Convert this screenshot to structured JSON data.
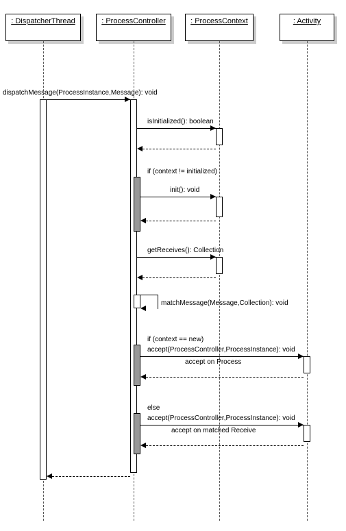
{
  "lifelines": {
    "dispatcher": ": DispatcherThread",
    "controller": ": ProcessController",
    "context": ": ProcessContext",
    "activity": ": Activity"
  },
  "messages": {
    "dispatch": "dispatchMessage(ProcessInstance,Message): void",
    "isInitialized": "isInitialized(): boolean",
    "guard_not_init": "if (context != initialized)",
    "init": "init(): void",
    "getReceives": "getReceives(): Collection",
    "matchMessage": "matchMessage(Message,Collection): void",
    "guard_new": "if (context == new)",
    "accept1": "accept(ProcessController,ProcessInstance): void",
    "accept1_note": "accept on Process",
    "guard_else": "else",
    "accept2": "accept(ProcessController,ProcessInstance): void",
    "accept2_note": "accept on matched Receive"
  },
  "chart_data": {
    "type": "sequence_diagram",
    "lifelines": [
      "DispatcherThread",
      "ProcessController",
      "ProcessContext",
      "Activity"
    ],
    "messages": [
      {
        "from": "DispatcherThread",
        "to": "ProcessController",
        "label": "dispatchMessage(ProcessInstance,Message): void",
        "kind": "sync"
      },
      {
        "from": "ProcessController",
        "to": "ProcessContext",
        "label": "isInitialized(): boolean",
        "kind": "sync"
      },
      {
        "from": "ProcessContext",
        "to": "ProcessController",
        "label": "",
        "kind": "return"
      },
      {
        "guard": "if (context != initialized)",
        "messages": [
          {
            "from": "ProcessController",
            "to": "ProcessContext",
            "label": "init(): void",
            "kind": "sync"
          },
          {
            "from": "ProcessContext",
            "to": "ProcessController",
            "label": "",
            "kind": "return"
          }
        ]
      },
      {
        "from": "ProcessController",
        "to": "ProcessContext",
        "label": "getReceives(): Collection",
        "kind": "sync"
      },
      {
        "from": "ProcessContext",
        "to": "ProcessController",
        "label": "",
        "kind": "return"
      },
      {
        "from": "ProcessController",
        "to": "ProcessController",
        "label": "matchMessage(Message,Collection): void",
        "kind": "self"
      },
      {
        "guard": "if (context == new)",
        "messages": [
          {
            "from": "ProcessController",
            "to": "Activity",
            "label": "accept(ProcessController,ProcessInstance): void",
            "note": "accept on Process",
            "kind": "sync"
          },
          {
            "from": "Activity",
            "to": "ProcessController",
            "label": "",
            "kind": "return"
          }
        ]
      },
      {
        "guard": "else",
        "messages": [
          {
            "from": "ProcessController",
            "to": "Activity",
            "label": "accept(ProcessController,ProcessInstance): void",
            "note": "accept on matched Receive",
            "kind": "sync"
          },
          {
            "from": "Activity",
            "to": "ProcessController",
            "label": "",
            "kind": "return"
          }
        ]
      },
      {
        "from": "ProcessController",
        "to": "DispatcherThread",
        "label": "",
        "kind": "return"
      }
    ]
  }
}
